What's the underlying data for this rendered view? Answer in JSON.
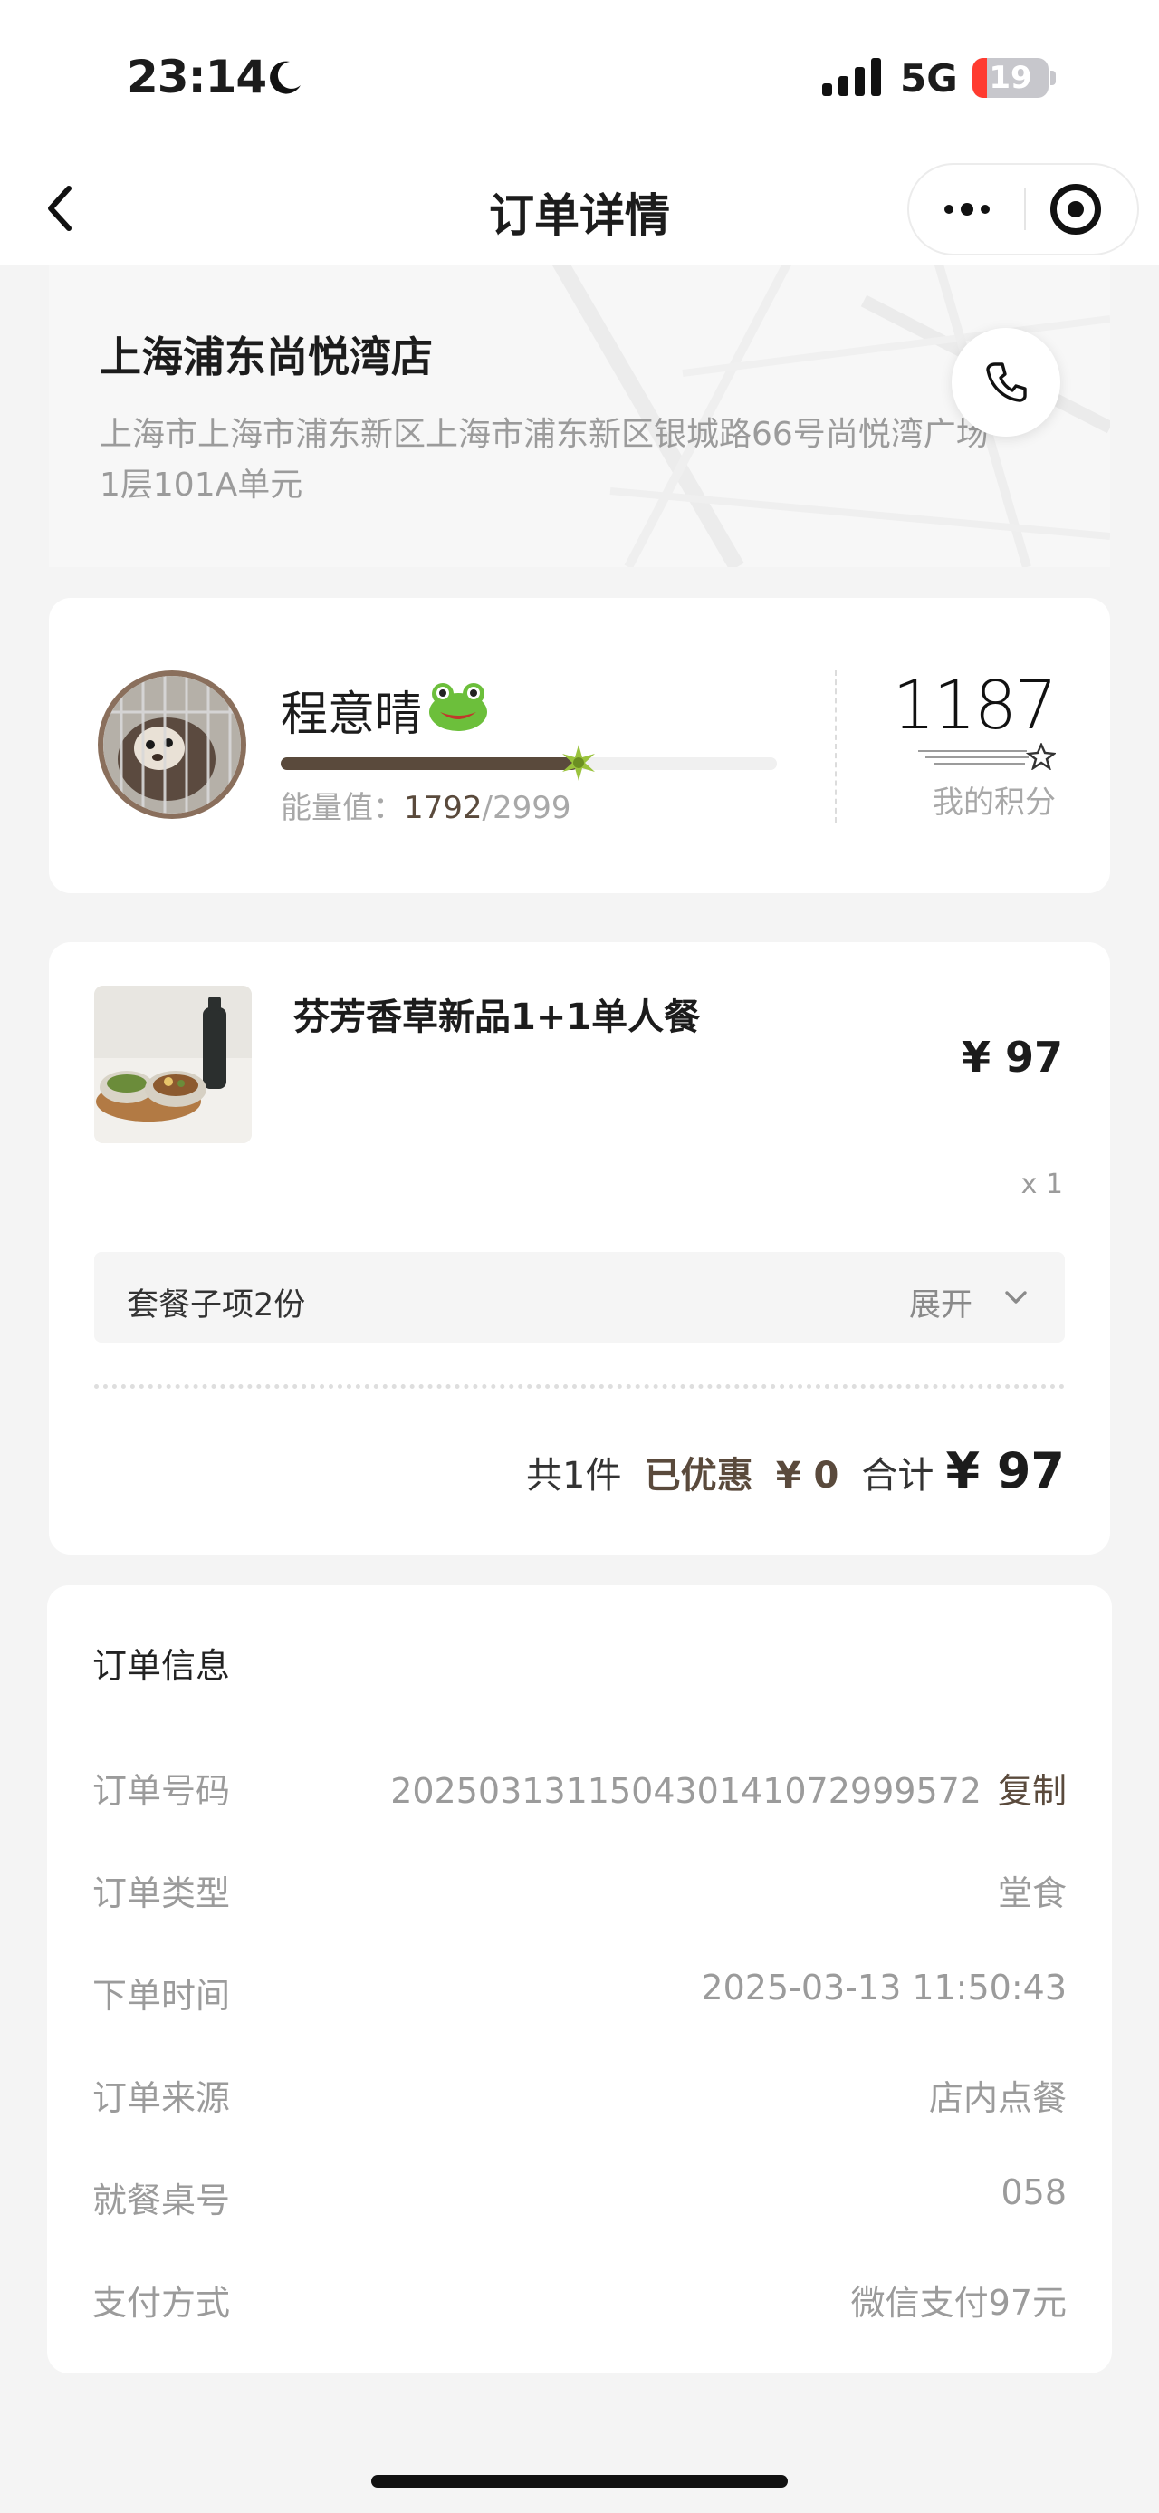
{
  "status_bar": {
    "time": "23:14",
    "network": "5G",
    "battery_level": "19",
    "battery_fraction": 0.19,
    "battery_color": "#ff3b30"
  },
  "nav": {
    "title": "订单详情",
    "back_icon": "chevron-left-icon",
    "more_icon": "more-dots-icon",
    "close_icon": "target-circle-icon"
  },
  "store": {
    "name": "上海浦东尚悦湾店",
    "address": "上海市上海市浦东新区上海市浦东新区银城路66号尚悦湾广场1层101A单元",
    "call_icon": "phone-icon"
  },
  "member": {
    "name": "程意晴",
    "name_emoji_icon": "frog-icon",
    "energy_label": "能量值：",
    "energy_current": "1792",
    "energy_separator": "/",
    "energy_max": "2999",
    "energy_fraction": 0.6,
    "points_value": "1187",
    "points_label": "我的积分",
    "accent_color": "#5a4a3c"
  },
  "order_items": {
    "items": [
      {
        "name": "芬芳香草新品1+1单人餐",
        "price": "¥ 97",
        "quantity": "x 1"
      }
    ],
    "combo": {
      "label": "套餐子项2份",
      "expand_label": "展开",
      "expand_icon": "chevron-down-icon"
    },
    "summary": {
      "count": "共1件",
      "discount_label": "已优惠",
      "discount_value": "¥ 0",
      "total_label": "合计",
      "total_value": "¥ 97"
    }
  },
  "order_info": {
    "title": "订单信息",
    "copy_label": "复制",
    "rows": [
      {
        "label": "订单号码",
        "value": "2025031311504301410729995 72"
      },
      {
        "label": "订单类型",
        "value": "堂食"
      },
      {
        "label": "下单时间",
        "value": "2025-03-13 11:50:43"
      },
      {
        "label": "订单来源",
        "value": "店内点餐"
      },
      {
        "label": "就餐桌号",
        "value": "058"
      },
      {
        "label": "支付方式",
        "value": "微信支付97元"
      }
    ]
  }
}
